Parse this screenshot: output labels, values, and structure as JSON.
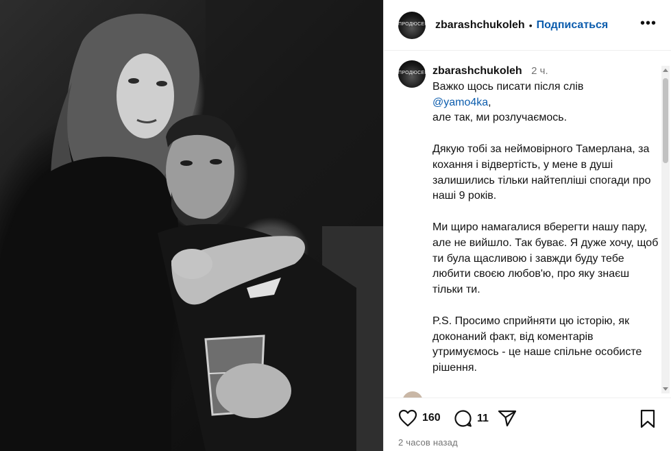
{
  "photo": {
    "alt": "black and white portrait photo"
  },
  "header": {
    "avatar_text": "ПРОДЮСЕР",
    "username": "zbarashchukoleh",
    "separator": "•",
    "follow_label": "Подписаться",
    "more_label": "•••"
  },
  "caption": {
    "username": "zbarashchukoleh",
    "time": "2 ч.",
    "line1": "Важко щось писати після слів",
    "mention": "@yamo4ka",
    "mention_suffix": ",",
    "line3": "але так, ми розлучаємось.",
    "para2": "Дякую тобі за неймовірного Тамерлана, за кохання і відвертість, у мене в душі залишились тільки найтепліші спогади про наші 9 років.",
    "para3": "Ми щиро намагалися вберегти нашу пару, але не вийшло. Так буває. Я дуже хочу, щоб ти була щасливою і завжди буду тебе любити своєю любов'ю, про яку знаєш тільки ти.",
    "para4": "P.S. Просимо сприйняти цю історію, як доконаний факт, від коментарів утримуємось - це наше спільне особисте рішення."
  },
  "actions": {
    "likes": "160",
    "comments": "11",
    "icons": [
      "heart-icon",
      "comment-icon",
      "share-icon",
      "bookmark-icon"
    ]
  },
  "timestamp": "2 часов назад"
}
